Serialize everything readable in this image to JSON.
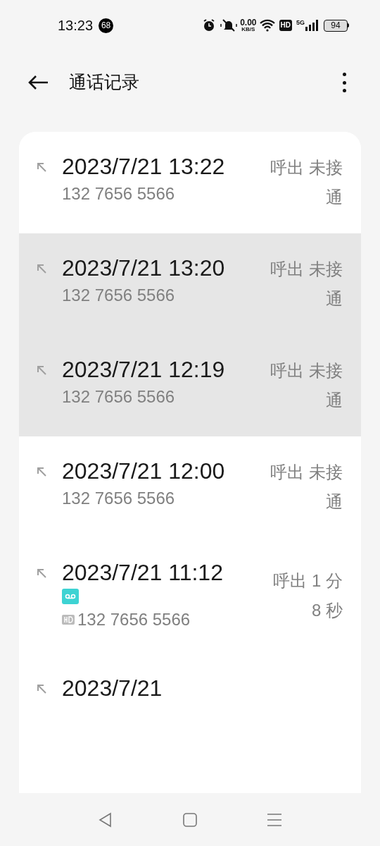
{
  "status_bar": {
    "time": "13:23",
    "notification_count": "68",
    "net_speed": "0.00",
    "net_unit": "KB/S",
    "hd": "HD",
    "network": "5G",
    "battery": "94"
  },
  "header": {
    "title": "通话记录"
  },
  "calls": [
    {
      "datetime": "2023/7/21 13:22",
      "number": "132 7656 5566",
      "status": "呼出 未接通",
      "selected": false
    },
    {
      "datetime": "2023/7/21 13:20",
      "number": "132 7656 5566",
      "status": "呼出 未接通",
      "selected": true
    },
    {
      "datetime": "2023/7/21 12:19",
      "number": "132 7656 5566",
      "status": "呼出 未接通",
      "selected": true
    },
    {
      "datetime": "2023/7/21 12:00",
      "number": "132 7656 5566",
      "status": "呼出 未接通",
      "selected": false
    },
    {
      "datetime": "2023/7/21 11:12",
      "number": "132 7656 5566",
      "status": "呼出 1 分 8 秒",
      "selected": false,
      "recorded": true,
      "hd_call": true
    },
    {
      "datetime": "2023/7/21",
      "selected": false
    }
  ]
}
